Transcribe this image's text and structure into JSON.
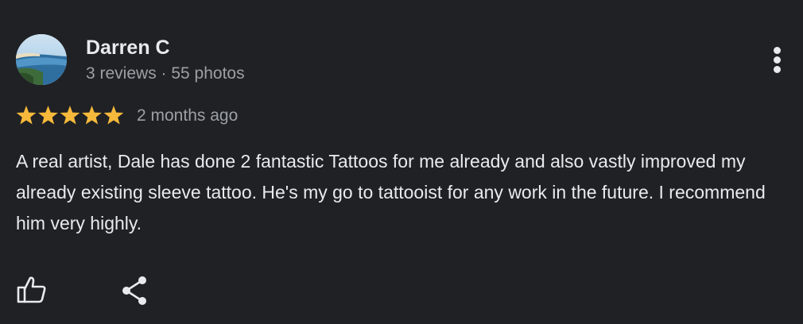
{
  "review": {
    "reviewer_name": "Darren C",
    "reviewer_meta": "3 reviews · 55 photos",
    "rating": 5,
    "rating_max": 5,
    "date": "2 months ago",
    "text": "A real artist, Dale has done 2 fantastic Tattoos for me already and also vastly improved my already existing sleeve tattoo. He's my go to tattooist for any work in the future. I recommend him very highly."
  },
  "icons": {
    "more": "more-vert-icon",
    "like": "thumb-up-icon",
    "share": "share-icon"
  },
  "colors": {
    "background": "#202124",
    "primary_text": "#e8eaed",
    "secondary_text": "#9aa0a6",
    "star": "#f6b93b"
  }
}
